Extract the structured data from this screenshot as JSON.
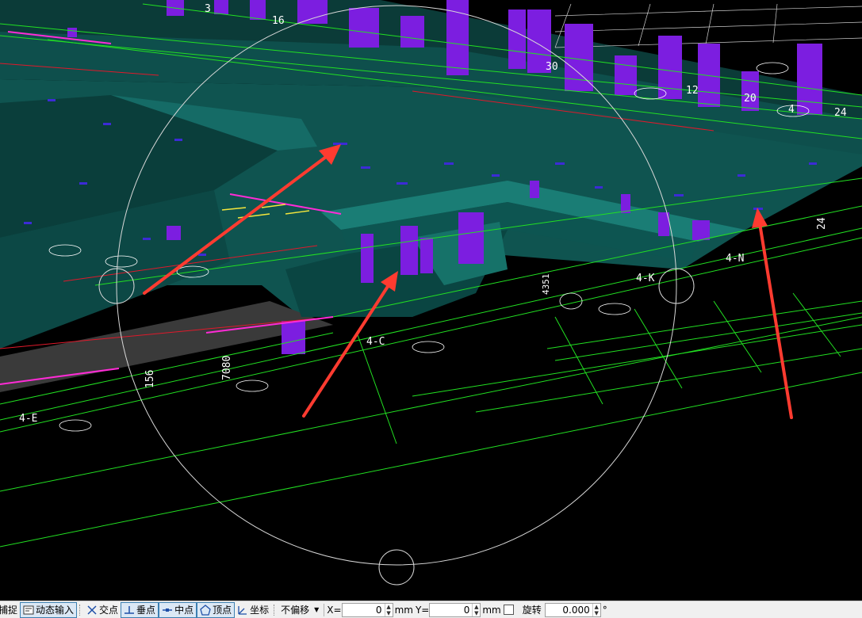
{
  "viewport": {
    "labels": {
      "n16": "16",
      "n3": "3",
      "n30": "30",
      "n12": "12",
      "n20": "20",
      "n4": "4",
      "n24": "24",
      "n24b": "24",
      "n156": "156",
      "n7080": "7080",
      "n4351": "4351",
      "ax4n": "4-N",
      "ax4k": "4-K",
      "ax4c": "4-C",
      "ax4e": "4-E"
    },
    "colors": {
      "background": "#000000",
      "slab": "#0e4f4c",
      "slab_light": "#157a72",
      "column": "#7c1ee0",
      "grid_line": "#22e022",
      "arrow": "#ff3b30",
      "axis_red": "#e0192b"
    }
  },
  "statusbar": {
    "snap": "捕捉",
    "dynamic_input": "动态输入",
    "intersection": "交点",
    "perpendicular": "垂点",
    "midpoint": "中点",
    "vertex": "顶点",
    "coordinate": "坐标",
    "offset_mode": "不偏移",
    "x_label": "X=",
    "x_value": "0",
    "x_unit": "mm",
    "y_label": "Y=",
    "y_value": "0",
    "y_unit": "mm",
    "rotate_label": "旋转",
    "rotate_value": "0.000",
    "degree": "°"
  }
}
